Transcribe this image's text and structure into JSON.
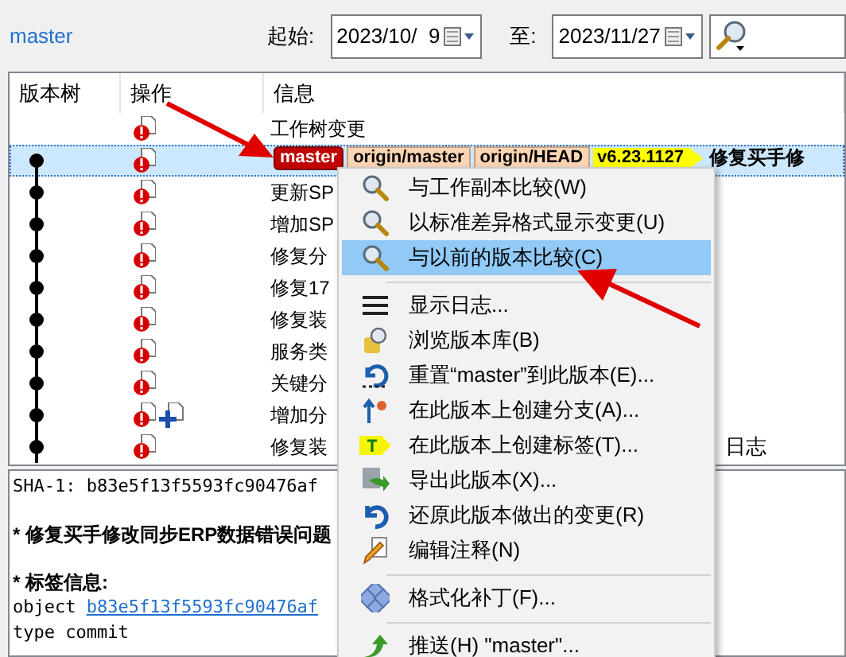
{
  "branch_link": "master",
  "date_from": {
    "label": "起始:",
    "value": "2023/10/  9"
  },
  "date_to": {
    "label": "至:",
    "value": "2023/11/27"
  },
  "log": {
    "columns": [
      "版本树",
      "操作",
      "信息"
    ],
    "rows": [
      {
        "commit": false,
        "selected": false,
        "added": false,
        "message": "工作树变更"
      },
      {
        "commit": true,
        "selected": true,
        "added": false,
        "refs": [
          {
            "text": "master",
            "kind": "branch"
          },
          {
            "text": "origin/master",
            "kind": "remote"
          },
          {
            "text": "origin/HEAD",
            "kind": "remote"
          },
          {
            "text": "v6.23.1127",
            "kind": "tag"
          }
        ],
        "message": "修复买手修"
      },
      {
        "commit": true,
        "selected": false,
        "added": false,
        "message": "更新SP"
      },
      {
        "commit": true,
        "selected": false,
        "added": false,
        "message": "增加SP"
      },
      {
        "commit": true,
        "selected": false,
        "added": false,
        "message": "修复分"
      },
      {
        "commit": true,
        "selected": false,
        "added": false,
        "message": "修复17"
      },
      {
        "commit": true,
        "selected": false,
        "added": false,
        "message": "修复装"
      },
      {
        "commit": true,
        "selected": false,
        "added": false,
        "message": "服务类"
      },
      {
        "commit": true,
        "selected": false,
        "added": false,
        "message": "关键分"
      },
      {
        "commit": true,
        "selected": false,
        "added": true,
        "message": "增加分"
      },
      {
        "commit": true,
        "selected": false,
        "added": false,
        "message": "修复装",
        "message_end": "日志"
      }
    ]
  },
  "details": [
    {
      "kind": "mono",
      "text": "SHA-1: b83e5f13f5593fc90476af"
    },
    {
      "kind": "heading",
      "text": "* 修复买手修改同步ERP数据错误问题"
    },
    {
      "kind": "heading",
      "text": "* 标签信息:"
    },
    {
      "kind": "link_line",
      "text": "object ",
      "link": "b83e5f13f5593fc90476af"
    },
    {
      "kind": "mono",
      "text": "type commit"
    }
  ],
  "context_menu": {
    "groups": [
      [
        {
          "label": "与工作副本比较(W)",
          "selected": false
        },
        {
          "label": "以标准差异格式显示变更(U)",
          "selected": false
        },
        {
          "label": "与以前的版本比较(C)",
          "selected": true
        }
      ],
      [
        {
          "label": "显示日志...",
          "selected": false
        },
        {
          "label": "浏览版本库(B)",
          "selected": false
        },
        {
          "label": "重置“master”到此版本(E)...",
          "selected": false
        },
        {
          "label": "在此版本上创建分支(A)...",
          "selected": false
        },
        {
          "label": "在此版本上创建标签(T)...",
          "selected": false
        },
        {
          "label": "导出此版本(X)...",
          "selected": false
        },
        {
          "label": "还原此版本做出的变更(R)",
          "selected": false
        },
        {
          "label": "编辑注释(N)",
          "selected": false
        }
      ],
      [
        {
          "label": "格式化补丁(F)...",
          "selected": false
        }
      ],
      [
        {
          "label": "推送(H) \"master\"...",
          "selected": false
        }
      ]
    ]
  }
}
